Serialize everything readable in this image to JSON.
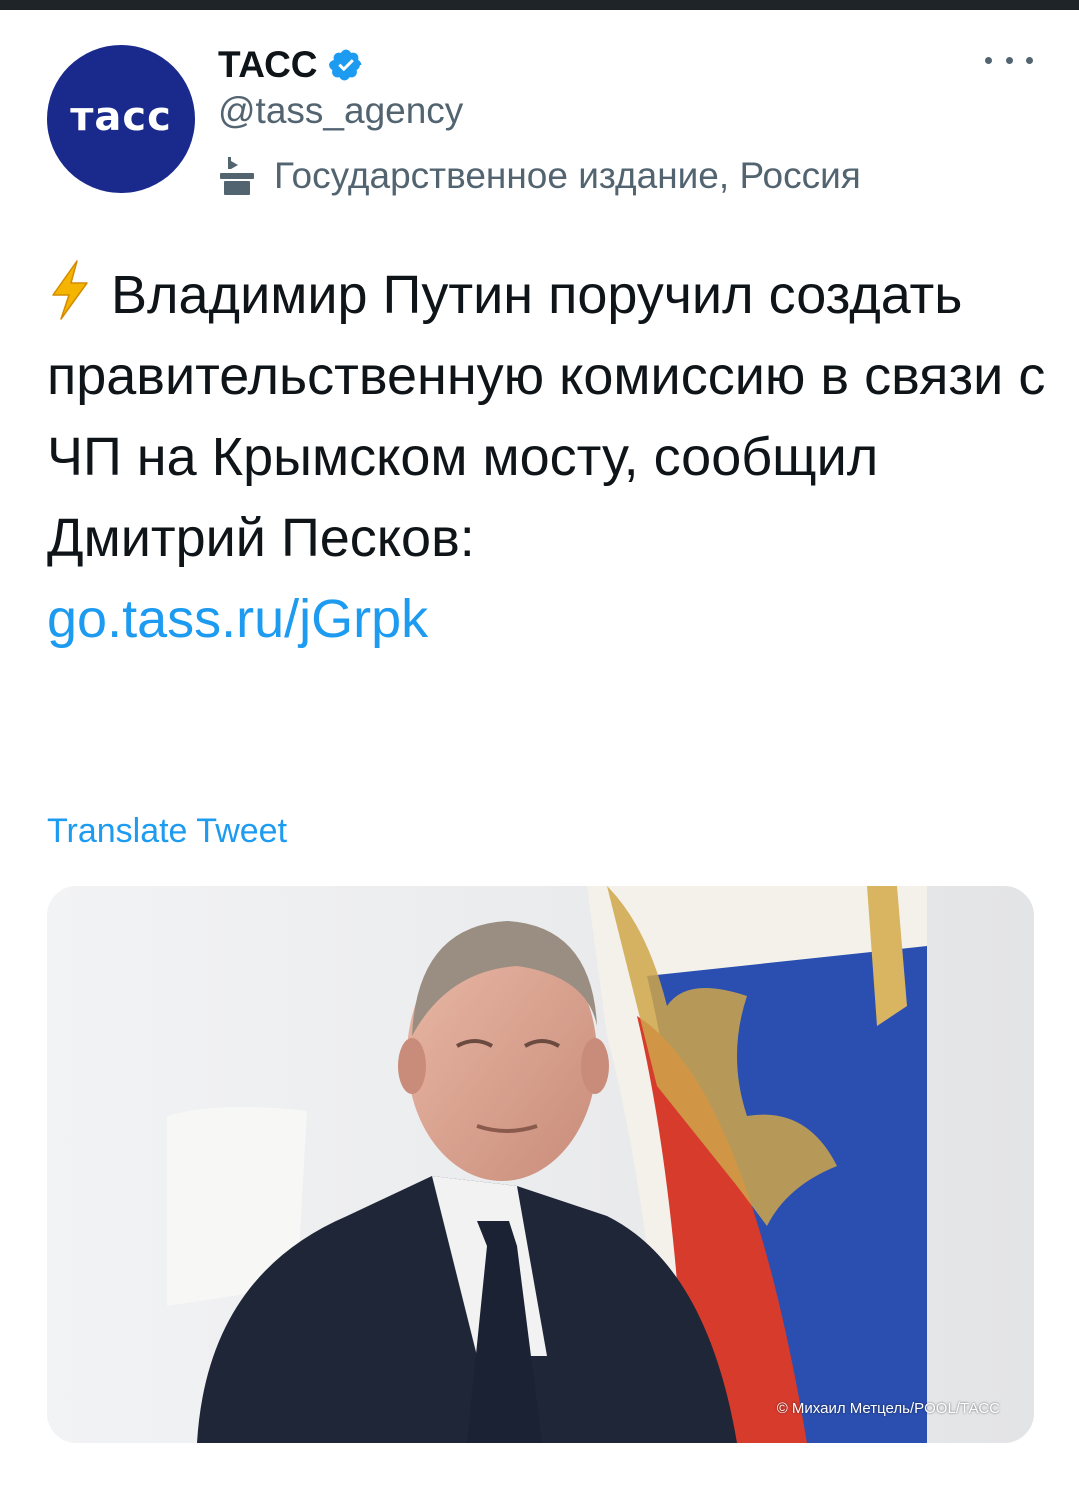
{
  "account": {
    "name": "ТАСС",
    "handle": "@tass_agency",
    "label": "Государственное издание, Россия",
    "avatar_text": "тасс",
    "verified": true
  },
  "tweet": {
    "text": "Владимир Путин поручил создать правительственную комиссию в связи с ЧП на Крымском мосту, сообщил Дмитрий Песков:",
    "link": "go.tass.ru/jGrpk",
    "translate_label": "Translate Tweet"
  },
  "media": {
    "credit": "© Михаил Метцель/POOL/ТАСС"
  },
  "icons": {
    "verified": "verified-badge-icon",
    "more": "more-options-icon",
    "state_media": "state-media-podium-icon",
    "bolt": "lightning-bolt-icon"
  },
  "colors": {
    "link": "#1d9bf0",
    "secondary_text": "#536471",
    "avatar_bg": "#1a2a8c"
  }
}
